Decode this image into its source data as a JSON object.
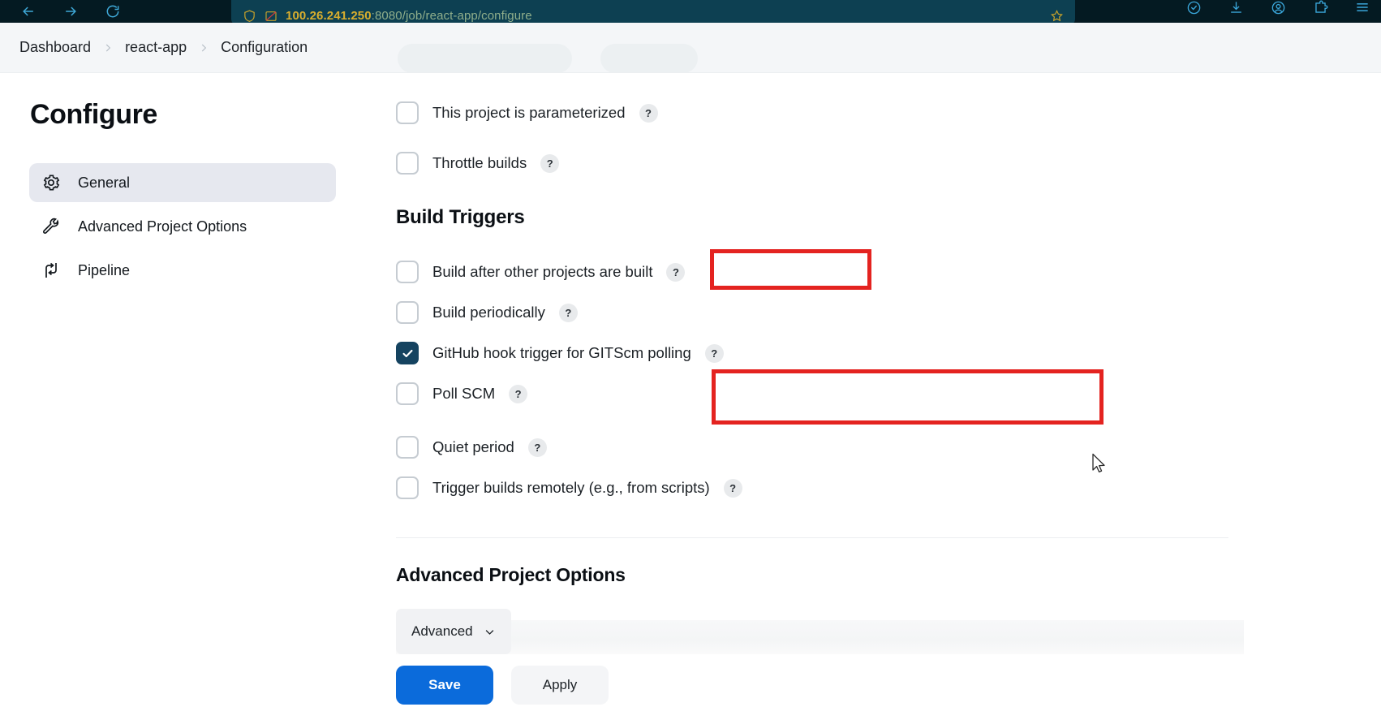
{
  "browser": {
    "nav": {
      "back_icon": "arrow-left-icon",
      "forward_icon": "arrow-right-icon",
      "reload_icon": "reload-icon"
    },
    "url": {
      "host": "100.26.241.250",
      "path": ":8080/job/react-app/configure",
      "full": "100.26.241.250:8080/job/react-app/configure",
      "shield_icon": "shield-icon",
      "page_icon": "broken-image-icon",
      "bookmark_icon": "star-icon"
    },
    "toolbar_icons": [
      "shield-check-icon",
      "downloads-icon",
      "account-icon",
      "extensions-icon",
      "app-menu-icon"
    ]
  },
  "breadcrumb": {
    "items": [
      {
        "label": "Dashboard"
      },
      {
        "label": "react-app"
      },
      {
        "label": "Configuration"
      }
    ],
    "separator": "chevron-right-icon"
  },
  "sidebar": {
    "title": "Configure",
    "items": [
      {
        "label": "General",
        "icon": "gear-icon",
        "active": true
      },
      {
        "label": "Advanced Project Options",
        "icon": "wrench-icon",
        "active": false
      },
      {
        "label": "Pipeline",
        "icon": "pipeline-icon",
        "active": false
      }
    ]
  },
  "main": {
    "top_options": [
      {
        "label": "This project is parameterized",
        "checked": false,
        "help": "?"
      },
      {
        "label": "Throttle builds",
        "checked": false,
        "help": "?"
      }
    ],
    "build_triggers": {
      "heading": "Build Triggers",
      "options": [
        {
          "label": "Build after other projects are built",
          "checked": false,
          "help": "?"
        },
        {
          "label": "Build periodically",
          "checked": false,
          "help": "?"
        },
        {
          "label": "GitHub hook trigger for GITScm polling",
          "checked": true,
          "help": "?"
        },
        {
          "label": "Poll SCM",
          "checked": false,
          "help": "?"
        },
        {
          "label": "Quiet period",
          "checked": false,
          "help": "?"
        },
        {
          "label": "Trigger builds remotely (e.g., from scripts)",
          "checked": false,
          "help": "?"
        }
      ]
    },
    "advanced_section": {
      "heading": "Advanced Project Options",
      "advanced_button": "Advanced",
      "advanced_chevron": "chevron-down-icon"
    },
    "actions": {
      "save_label": "Save",
      "apply_label": "Apply"
    }
  },
  "annotations": [
    {
      "name": "build-triggers-highlight",
      "target": "Build Triggers",
      "color": "#e42320"
    },
    {
      "name": "github-hook-highlight",
      "target": "GitHub hook trigger for GITScm polling",
      "color": "#e42320"
    }
  ],
  "colors": {
    "accent_blue": "#0b6bdb",
    "checkbox_checked": "#154360",
    "annotation_red": "#e42320",
    "chrome_bg": "#041a22",
    "urlbar_bg": "#0d4052",
    "header_bg": "#f4f6f8",
    "sidebar_active": "#e6e8ef"
  }
}
